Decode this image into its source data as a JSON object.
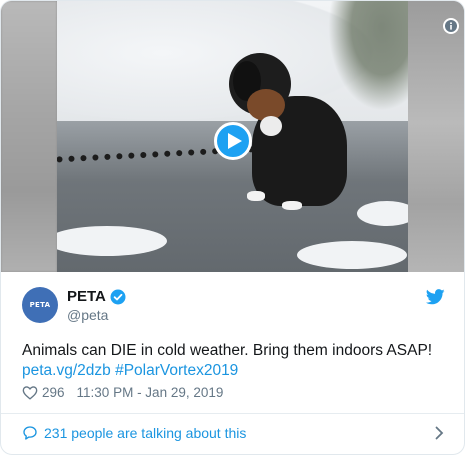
{
  "media": {
    "type": "video",
    "play_icon": "play-icon",
    "info_icon": "info-icon"
  },
  "author": {
    "display_name": "PETA",
    "handle": "@peta",
    "verified": true,
    "avatar_text": "PETA"
  },
  "tweet": {
    "text": "Animals can DIE in cold weather. Bring them indoors ASAP! ",
    "link": "peta.vg/2dzb",
    "hashtag": "#PolarVortex2019",
    "likes": "296",
    "timestamp": "11:30 PM - Jan 29, 2019"
  },
  "conversation": {
    "label": "231 people are talking about this"
  },
  "colors": {
    "brand": "#1da1f2",
    "link": "#1b95e0",
    "muted": "#657786",
    "text": "#14171a"
  }
}
